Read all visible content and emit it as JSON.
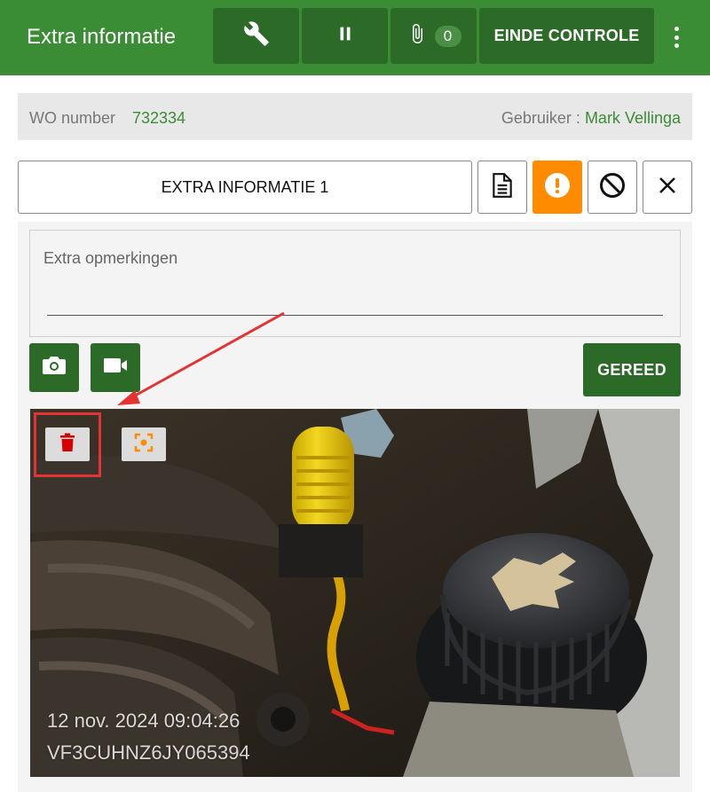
{
  "header": {
    "title": "Extra informatie",
    "attachments_count": "0",
    "end_label": "EINDE CONTROLE",
    "icons": [
      "wrench-icon",
      "pause-icon",
      "paperclip-icon",
      "more-vert-icon"
    ],
    "colors": {
      "bar": "#3a8c35",
      "button": "#2c6a28"
    }
  },
  "info": {
    "wo_label": "WO number",
    "wo_value": "732334",
    "user_label": "Gebruiker : ",
    "user_value": "Mark Vellinga"
  },
  "item": {
    "title": "EXTRA INFORMATIE 1",
    "icons": [
      "document-icon",
      "warning-icon",
      "block-icon",
      "close-icon"
    ],
    "warning_color": "#ff8c00"
  },
  "remarks": {
    "placeholder": "Extra opmerkingen"
  },
  "actions": {
    "done_label": "GEREED",
    "icons": [
      "camera-icon",
      "videocam-icon"
    ]
  },
  "photo": {
    "timestamp": "12 nov. 2024 09:04:26",
    "vin": "VF3CUHNZ6JY065394",
    "icons": [
      "delete-icon",
      "focus-icon"
    ],
    "delete_color": "#d50000",
    "focus_color": "#ff8c00"
  },
  "annotation": {
    "color": "#e53333"
  }
}
